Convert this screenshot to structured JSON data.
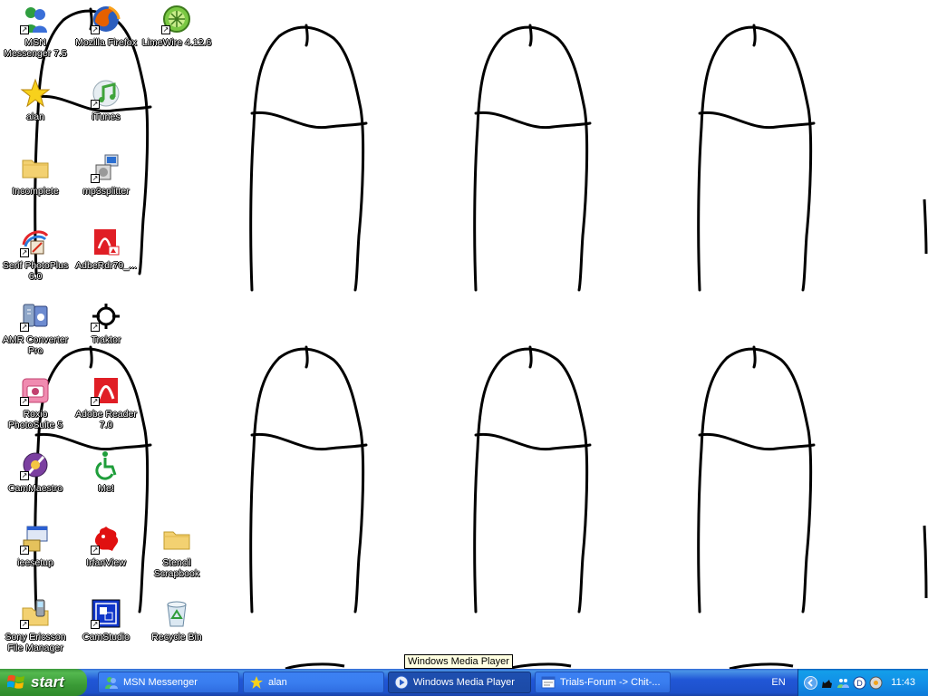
{
  "desktop": {
    "icons": [
      {
        "label": "MSN Messenger 7.5",
        "icon": "msn-messenger-icon"
      },
      {
        "label": "Mozilla Firefox",
        "icon": "firefox-icon"
      },
      {
        "label": "LimeWire 4.12.6",
        "icon": "limewire-icon"
      },
      {
        "label": "alan",
        "icon": "star-icon"
      },
      {
        "label": "iTunes",
        "icon": "itunes-icon"
      },
      {
        "label": "Incomplete",
        "icon": "folder-icon"
      },
      {
        "label": "mp3splitter",
        "icon": "mp3splitter-icon"
      },
      {
        "label": "Serif PhotoPlus 6.0",
        "icon": "photoplus-icon"
      },
      {
        "label": "AdbeRdr70_...",
        "icon": "adobe-installer-icon"
      },
      {
        "label": "AMR Converter Pro",
        "icon": "amr-converter-icon"
      },
      {
        "label": "Traktor",
        "icon": "traktor-icon"
      },
      {
        "label": "Roxio PhotoSuite 5",
        "icon": "roxio-icon"
      },
      {
        "label": "Adobe Reader 7.0",
        "icon": "adobe-reader-icon"
      },
      {
        "label": "CamMaestro",
        "icon": "cammaestro-icon"
      },
      {
        "label": "Me!",
        "icon": "accessibility-icon"
      },
      {
        "label": "ieesetup",
        "icon": "setup-icon"
      },
      {
        "label": "IrfanView",
        "icon": "irfanview-icon"
      },
      {
        "label": "Stencil Scrapbook",
        "icon": "folder-icon"
      },
      {
        "label": "Sony Ericsson File Manager",
        "icon": "phone-folder-icon"
      },
      {
        "label": "CamStudio",
        "icon": "camstudio-icon"
      },
      {
        "label": "Recycle Bin",
        "icon": "recycle-bin-icon"
      }
    ]
  },
  "taskbar": {
    "start_label": "start",
    "tasks": [
      {
        "label": "MSN Messenger",
        "icon": "msn-messenger-icon",
        "active": false
      },
      {
        "label": "alan",
        "icon": "star-icon",
        "active": false
      },
      {
        "label": "Windows Media Player",
        "icon": "media-player-icon",
        "active": true
      },
      {
        "label": "Trials-Forum -> Chit-...",
        "icon": "browser-icon",
        "active": false
      }
    ],
    "language": "EN",
    "tray_icons": [
      "show-hidden-arrow-icon",
      "cat-icon",
      "network-icon",
      "messenger-tray-icon",
      "media-tray-icon"
    ],
    "clock": "11:43"
  },
  "tooltip": "Windows Media Player",
  "colors": {
    "taskbar_blue": "#245edb",
    "start_green": "#3c9a3c",
    "tray_blue": "#1290e8",
    "tooltip_bg": "#ffffe1"
  }
}
